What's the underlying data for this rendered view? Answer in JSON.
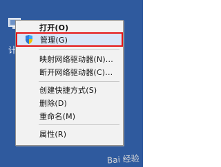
{
  "desktop": {
    "icon_label": "计"
  },
  "context_menu": {
    "items": [
      {
        "label": "打开(O)",
        "bold": true,
        "selected": false,
        "highlighted": false,
        "icon": ""
      },
      {
        "label": "管理(G)",
        "bold": false,
        "selected": true,
        "highlighted": true,
        "icon": "shield-icon"
      },
      {
        "label": "映射网络驱动器(N)...",
        "bold": false,
        "selected": false,
        "highlighted": false,
        "icon": ""
      },
      {
        "label": "断开网络驱动器(C)...",
        "bold": false,
        "selected": false,
        "highlighted": false,
        "icon": ""
      },
      {
        "label": "创建快捷方式(S)",
        "bold": false,
        "selected": false,
        "highlighted": false,
        "icon": ""
      },
      {
        "label": "删除(D)",
        "bold": false,
        "selected": false,
        "highlighted": false,
        "icon": ""
      },
      {
        "label": "重命名(M)",
        "bold": false,
        "selected": false,
        "highlighted": false,
        "icon": ""
      },
      {
        "label": "属性(R)",
        "bold": false,
        "selected": false,
        "highlighted": false,
        "icon": ""
      }
    ]
  },
  "watermark": {
    "text": "Bai 经验"
  },
  "colors": {
    "desktop": "#2f5a9e",
    "menu_background": "#f2f2f2",
    "menu_border": "#8d8d8d",
    "selected_fill": "#d9e6f8",
    "highlight_red": "#e51414"
  }
}
